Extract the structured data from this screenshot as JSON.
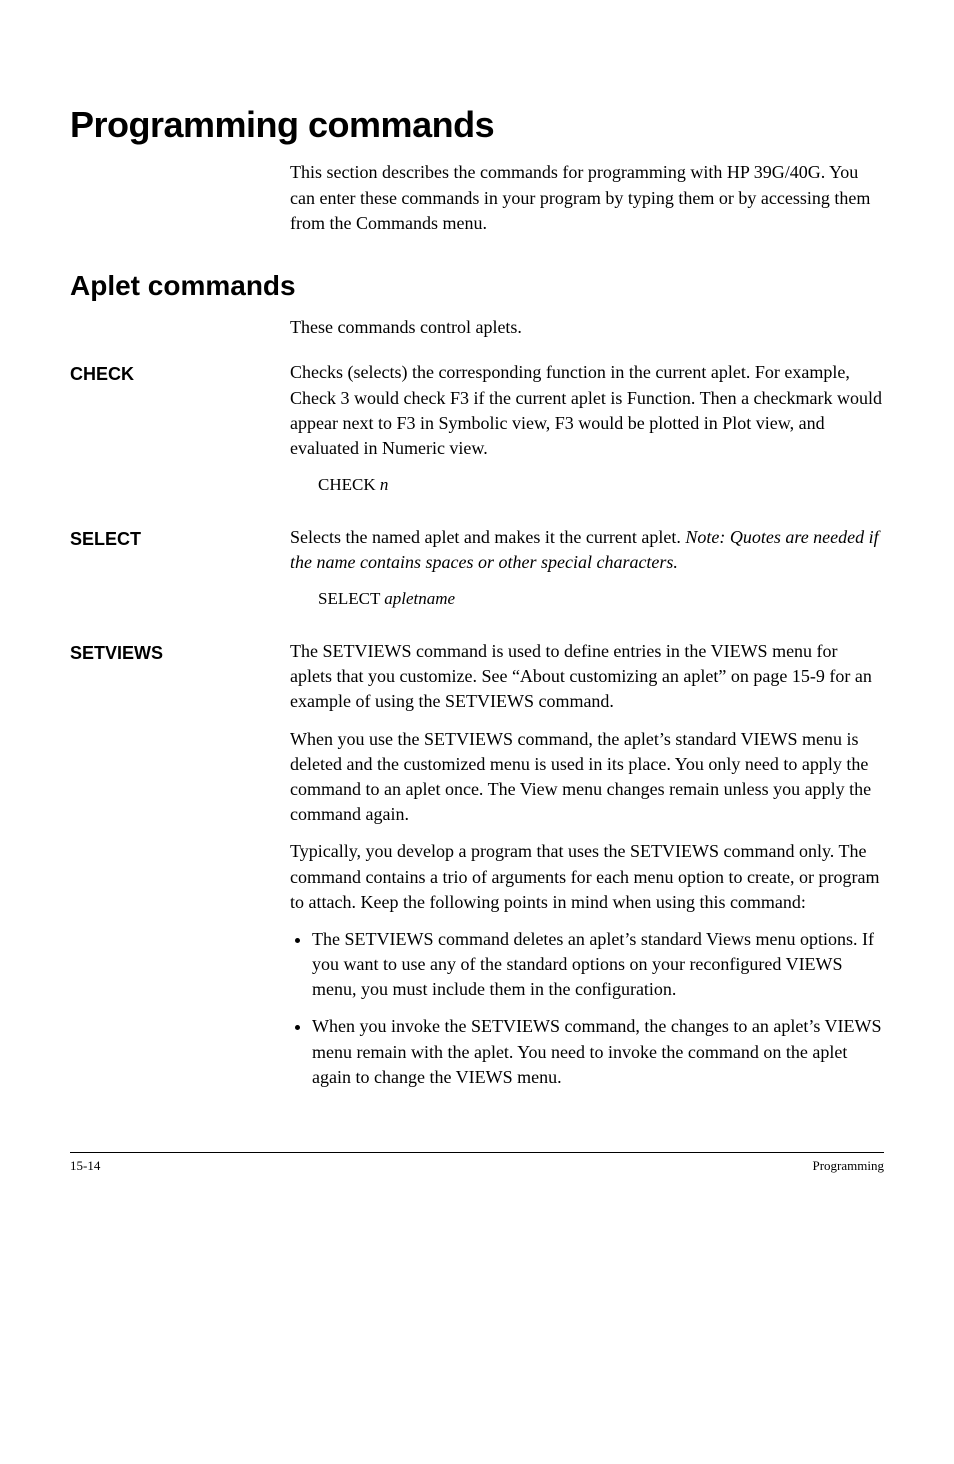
{
  "title_main": "Programming commands",
  "intro_main": "This section describes the commands for programming with HP 39G/40G. You can enter these commands in your program by typing them or by accessing them from the Commands menu.",
  "title_sub": "Aplet commands",
  "intro_sub": "These commands control aplets.",
  "check": {
    "label": "CHECK",
    "body": "Checks (selects) the corresponding function in the current aplet. For example, Check 3 would check F3 if the current aplet is Function. Then a checkmark would appear next to F3 in Symbolic view, F3 would be plotted in Plot view, and evaluated in Numeric view.",
    "syntax_cmd": "CHECK ",
    "syntax_arg": "n"
  },
  "select": {
    "label": "SELECT",
    "body_pre": "Selects the named aplet and makes it the current aplet. ",
    "body_note_label": "Note: ",
    "body_note": "Quotes are needed if the name contains spaces or other special characters.",
    "syntax_cmd": "SELECT ",
    "syntax_arg": "apletname"
  },
  "setviews": {
    "label": "SETVIEWS",
    "p1": "The SETVIEWS command is used to define entries in the VIEWS menu for aplets that you customize. See “About customizing an aplet” on page 15-9 for an example of using the SETVIEWS command.",
    "p2": "When you use the SETVIEWS command, the aplet’s standard VIEWS menu is deleted and the customized menu is used in its place. You only need to apply the command to an aplet once. The View menu changes remain unless you apply the command again.",
    "p3": "Typically, you develop a program that uses the SETVIEWS command only. The command contains a trio of arguments for each menu option to create, or program to attach. Keep the following points in mind when using this command:",
    "li1": "The SETVIEWS command deletes an aplet’s standard Views menu options. If you want to use any of the standard options on your reconfigured VIEWS menu, you must include them in the configuration.",
    "li2": "When you invoke the SETVIEWS command, the changes to an aplet’s VIEWS menu remain with the aplet. You need to invoke the command on the aplet again to change the VIEWS menu."
  },
  "footer": {
    "page": "15-14",
    "chapter": "Programming"
  }
}
